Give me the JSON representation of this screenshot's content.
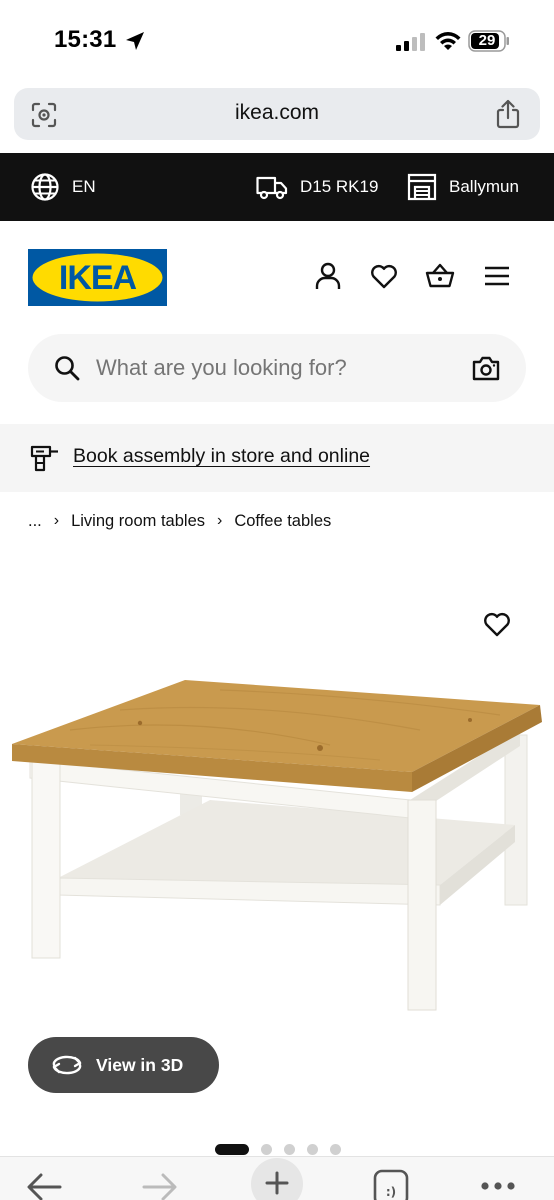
{
  "status_bar": {
    "time": "15:31",
    "battery": "29"
  },
  "address_bar": {
    "url": "ikea.com"
  },
  "top_bar": {
    "language": "EN",
    "postcode": "D15 RK19",
    "store": "Ballymun"
  },
  "header": {
    "logo_text": "IKEA"
  },
  "search": {
    "placeholder": "What are you looking for?"
  },
  "assembly_banner": {
    "link_text": "Book assembly in store and online"
  },
  "breadcrumb": {
    "ellipsis": "...",
    "items": [
      "Living room tables",
      "Coffee tables"
    ]
  },
  "product": {
    "view_3d_label": "View in 3D",
    "image_count": 5,
    "active_image": 1
  },
  "colors": {
    "ikea_blue": "#0058a3",
    "ikea_yellow": "#ffdb00",
    "black_bar": "#111111",
    "view3d_button": "#484848"
  }
}
